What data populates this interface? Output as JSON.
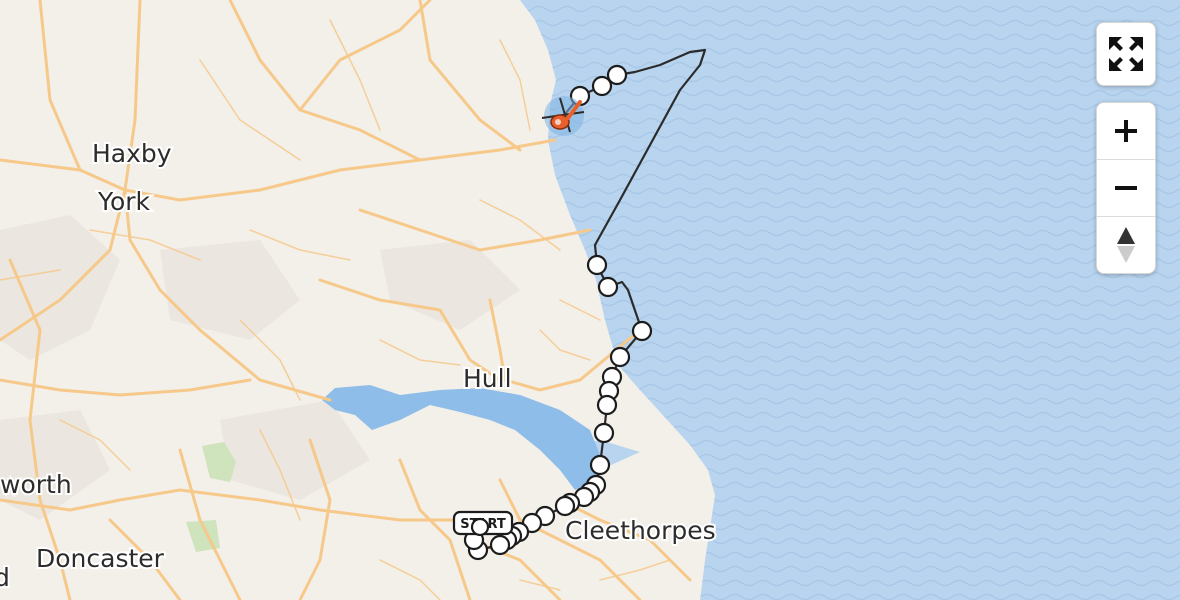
{
  "places": [
    {
      "name": "Haxby",
      "key": "haxby"
    },
    {
      "name": "York",
      "key": "york"
    },
    {
      "name": "Hull",
      "key": "hull"
    },
    {
      "name": "Cleethorpes",
      "key": "cleethorpes"
    },
    {
      "name": "Doncaster",
      "key": "doncaster"
    },
    {
      "name": "worth",
      "key": "worth-partial"
    },
    {
      "name": "d",
      "key": "d-partial"
    }
  ],
  "route": {
    "start_label": "START",
    "line_color": "#2b2b2b",
    "marker_color": "#ffffff",
    "helipad_color": "#e8612c"
  },
  "colors": {
    "sea": "#b9d4ee",
    "land": "#f3efe9",
    "roads": "#f6c98a",
    "estuary": "#8dbde8"
  },
  "controls": {
    "fullscreen_icon": "expand-arrows",
    "zoom_in_icon": "plus",
    "zoom_out_icon": "minus",
    "reset_north_icon": "compass-arrow"
  }
}
